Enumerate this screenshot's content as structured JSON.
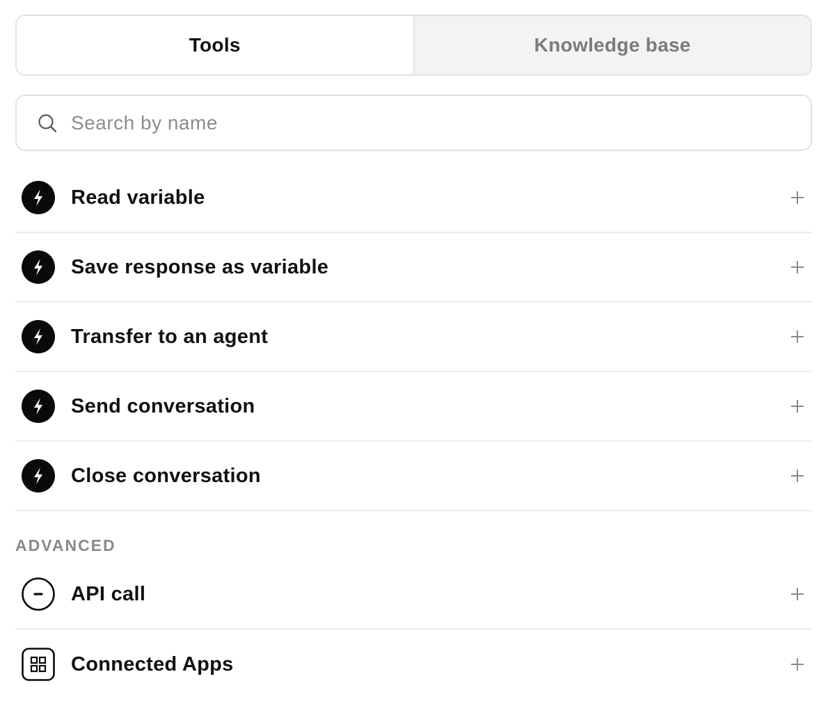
{
  "tabs": [
    {
      "label": "Tools",
      "active": true
    },
    {
      "label": "Knowledge base",
      "active": false
    }
  ],
  "search": {
    "placeholder": "Search by name",
    "value": "",
    "icon": "search-icon"
  },
  "tools": [
    {
      "label": "Read variable",
      "icon": "lightning-icon",
      "action_icon": "plus-icon"
    },
    {
      "label": "Save response as variable",
      "icon": "lightning-icon",
      "action_icon": "plus-icon"
    },
    {
      "label": "Transfer to an agent",
      "icon": "lightning-icon",
      "action_icon": "plus-icon"
    },
    {
      "label": "Send conversation",
      "icon": "lightning-icon",
      "action_icon": "plus-icon"
    },
    {
      "label": "Close conversation",
      "icon": "lightning-icon",
      "action_icon": "plus-icon"
    }
  ],
  "advanced": {
    "heading": "ADVANCED",
    "items": [
      {
        "label": "API call",
        "icon": "api-icon",
        "action_icon": "plus-icon"
      },
      {
        "label": "Connected Apps",
        "icon": "apps-grid-icon",
        "action_icon": "plus-icon"
      }
    ]
  },
  "colors": {
    "border": "#e2e3df",
    "inactive_tab_bg": "#f3f4f1",
    "inactive_tab_text": "#7b7b7b",
    "text": "#111111",
    "muted": "#8a8a8a",
    "divider": "#ececea"
  }
}
